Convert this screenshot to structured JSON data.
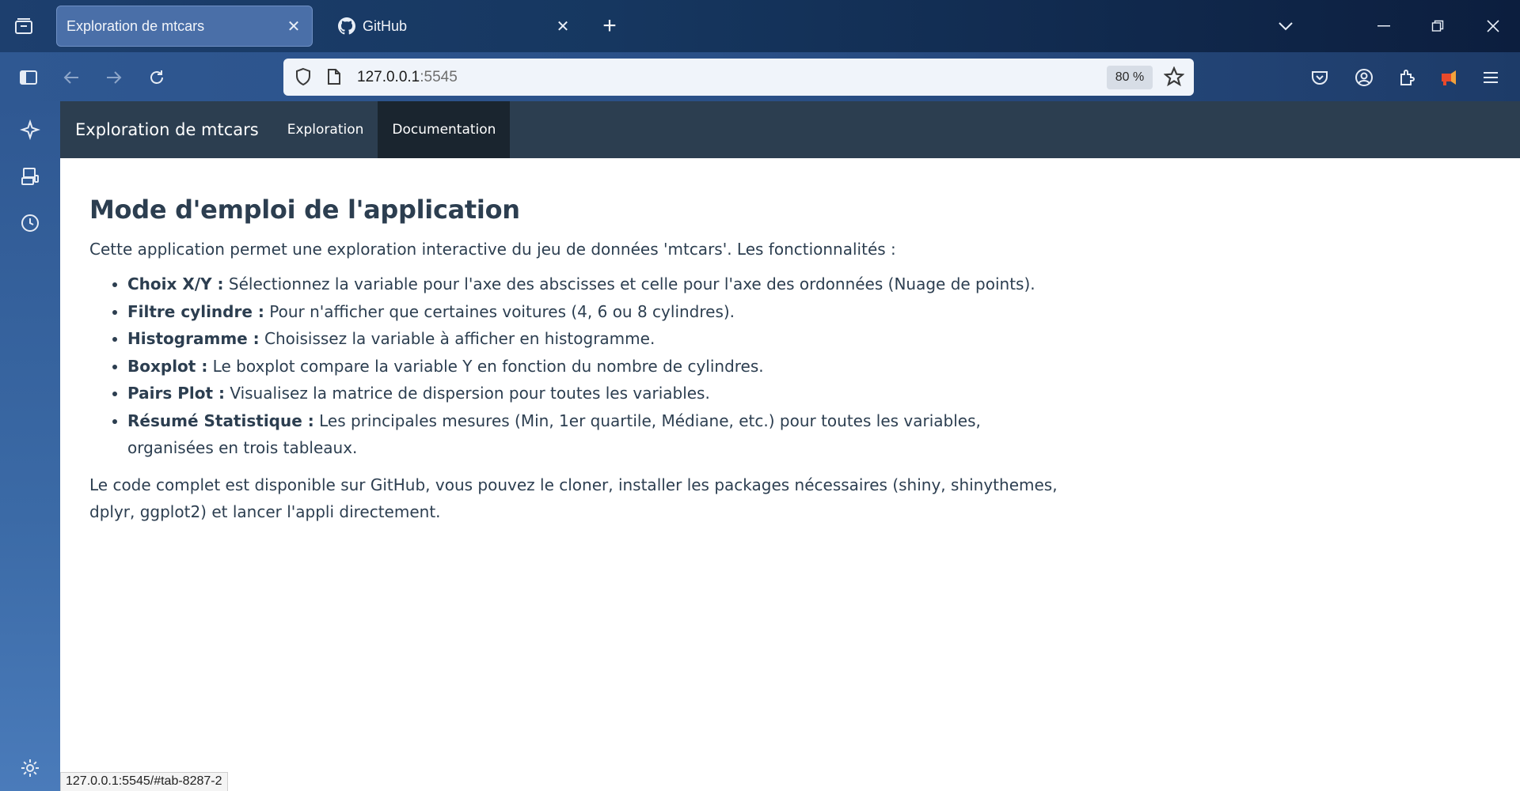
{
  "browser": {
    "tabs": [
      {
        "title": "Exploration de mtcars",
        "active": true
      },
      {
        "title": "GitHub",
        "active": false
      }
    ],
    "url_host": "127.0.0.1",
    "url_port": ":5545",
    "zoom": "80 %",
    "accent": "#2f5892"
  },
  "app": {
    "brand": "Exploration de mtcars",
    "tabs": [
      {
        "label": "Exploration",
        "active": false
      },
      {
        "label": "Documentation",
        "active": true
      }
    ]
  },
  "doc": {
    "title": "Mode d'emploi de l'application",
    "intro": "Cette application permet une exploration interactive du jeu de données 'mtcars'. Les fonctionnalités :",
    "features": [
      {
        "name": "Choix X/Y :",
        "desc": " Sélectionnez la variable pour l'axe des abscisses et celle pour l'axe des ordonnées (Nuage de points)."
      },
      {
        "name": "Filtre cylindre :",
        "desc": " Pour n'afficher que certaines voitures (4, 6 ou 8 cylindres)."
      },
      {
        "name": "Histogramme :",
        "desc": " Choisissez la variable à afficher en histogramme."
      },
      {
        "name": "Boxplot :",
        "desc": " Le boxplot compare la variable Y en fonction du nombre de cylindres."
      },
      {
        "name": "Pairs Plot :",
        "desc": " Visualisez la matrice de dispersion pour toutes les variables."
      },
      {
        "name": "Résumé Statistique :",
        "desc": " Les principales mesures (Min, 1er quartile, Médiane, etc.) pour toutes les variables, organisées en trois tableaux."
      }
    ],
    "code_note": "Le code complet est disponible sur GitHub, vous pouvez le cloner, installer les packages nécessaires (shiny, shinythemes, dplyr, ggplot2) et lancer l'appli directement."
  },
  "status_url": "127.0.0.1:5545/#tab-8287-2"
}
